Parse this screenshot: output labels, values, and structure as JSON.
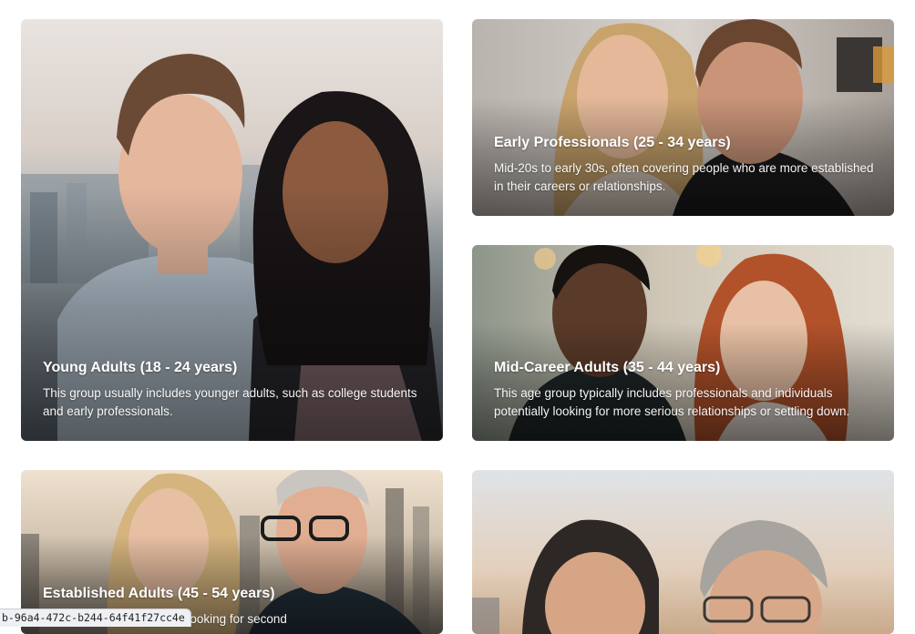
{
  "cards": [
    {
      "title": "Young Adults (18 - 24 years)",
      "description": "This group usually includes younger adults, such as college students and early professionals."
    },
    {
      "title": "Early Professionals (25 - 34 years)",
      "description": "Mid-20s to early 30s, often covering people who are more established in their careers or relationships."
    },
    {
      "title": "Mid-Career Adults (35 - 44 years)",
      "description": "This age group typically includes professionals and individuals potentially looking for more serious relationships or settling down."
    },
    {
      "title": "Established Adults (45 - 54 years)",
      "description": "...many of whom might be looking for second"
    },
    {
      "title": "",
      "description": ""
    }
  ],
  "status_url": "b-96a4-472c-b244-64f41f27cc4e"
}
